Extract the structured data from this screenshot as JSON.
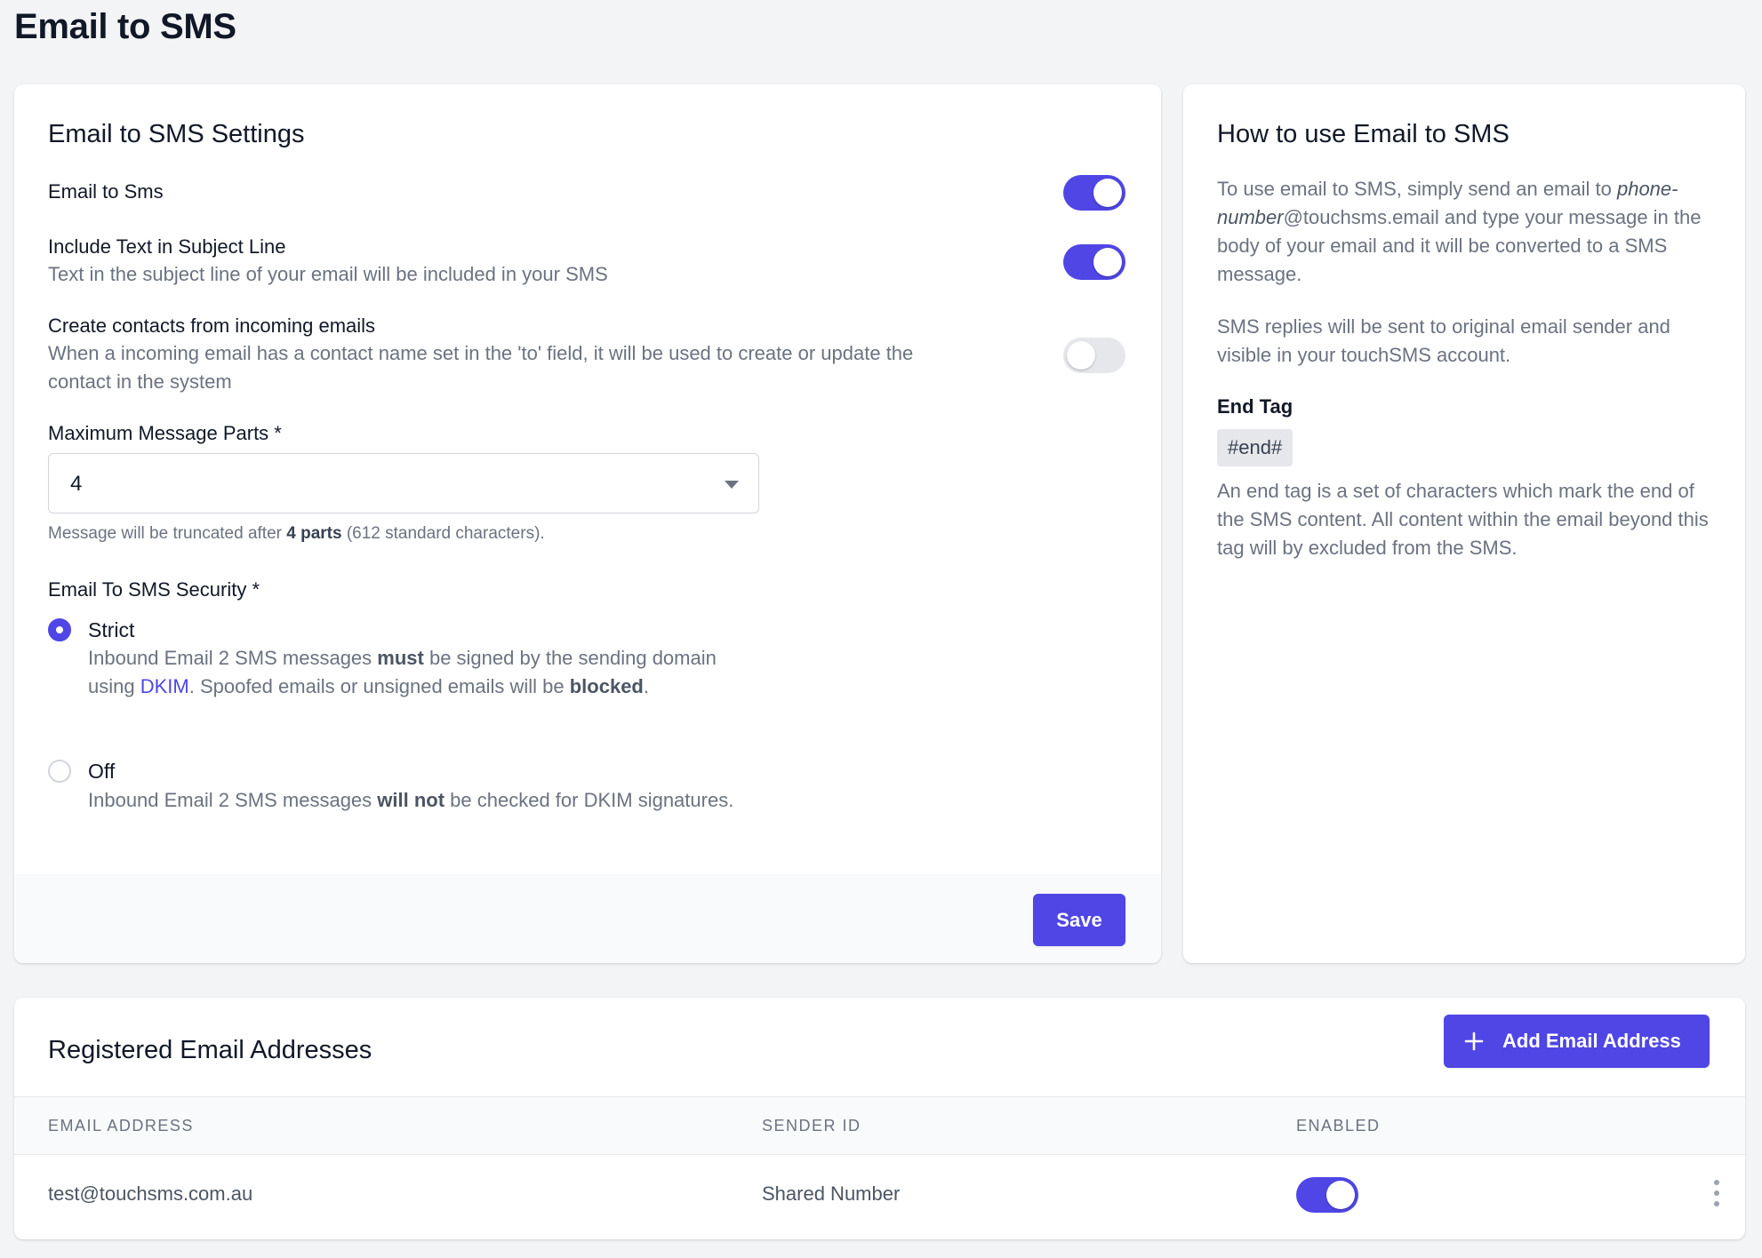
{
  "page": {
    "title": "Email to SMS"
  },
  "settings": {
    "title": "Email to SMS Settings",
    "email_to_sms": {
      "label": "Email to Sms",
      "enabled": true
    },
    "subject_line": {
      "label": "Include Text in Subject Line",
      "description": "Text in the subject line of your email will be included in your SMS",
      "enabled": true
    },
    "create_contacts": {
      "label": "Create contacts from incoming emails",
      "description_line1": "When a incoming email has a contact name set in the 'to' field, it will be used to create or update the",
      "description_line2": "contact in the system",
      "enabled": false
    },
    "max_parts": {
      "label": "Maximum Message Parts *",
      "value": "4",
      "hint_prefix": "Message will be truncated after ",
      "hint_bold": "4 parts",
      "hint_suffix": " (612 standard characters)."
    },
    "security": {
      "label": "Email To SMS Security *",
      "strict": {
        "title": "Strict",
        "selected": true,
        "d1": "Inbound Email 2 SMS messages ",
        "d_must": "must",
        "d2": " be signed by the sending domain using ",
        "d_link": "DKIM",
        "d3": ". Spoofed emails or unsigned emails will be ",
        "d_blocked": "blocked",
        "d4": "."
      },
      "off": {
        "title": "Off",
        "selected": false,
        "d1": "Inbound Email 2 SMS messages ",
        "d_willnot": "will not",
        "d2": " be checked for DKIM signatures."
      }
    },
    "save_label": "Save"
  },
  "howto": {
    "title": "How to use Email to SMS",
    "p1_italic": "phone-number",
    "p1_prefix": "To use email to SMS, simply send an email to ",
    "p1_suffix": "@touchsms.email and type your message in the body of your email and it will be converted to a SMS message.",
    "p2": "SMS replies will be sent to original email sender and visible in your touchSMS account.",
    "end_tag_label": "End Tag",
    "end_tag_value": "#end#",
    "p3": "An end tag is a set of characters which mark the end of the SMS content. All content within the email beyond this tag will by excluded from the SMS."
  },
  "registered": {
    "title": "Registered Email Addresses",
    "add_label": "Add Email Address",
    "columns": [
      "EMAIL ADDRESS",
      "SENDER ID",
      "ENABLED"
    ],
    "rows": [
      {
        "email": "test@touchsms.com.au",
        "sender": "Shared Number",
        "enabled": true
      }
    ]
  },
  "colors": {
    "accent": "#4f46e5",
    "background": "#f3f4f6",
    "muted_text": "#6b7280"
  },
  "icons": {
    "add": "plus-icon",
    "row_menu": "more-vertical-icon",
    "select": "chevron-down-icon"
  }
}
